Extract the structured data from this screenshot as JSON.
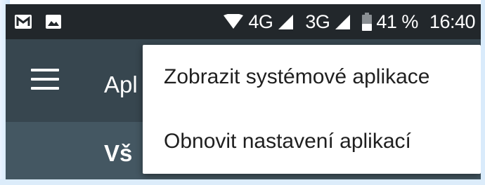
{
  "status_bar": {
    "notification_icons": [
      "gmail-icon",
      "image-icon"
    ],
    "signal_icons": [
      "wifi-icon",
      "signal-4g-icon",
      "signal-3g-icon",
      "battery-icon"
    ],
    "network_1": "4G",
    "network_2": "3G",
    "battery_percent": "41 %",
    "time": "16:40"
  },
  "toolbar": {
    "menu_icon": "hamburger-menu-icon",
    "title": "Apl"
  },
  "subheader": {
    "title": "Vš"
  },
  "overflow_menu": {
    "items": [
      {
        "label": "Zobrazit systémové aplikace"
      },
      {
        "label": "Obnovit nastavení aplikací"
      }
    ]
  },
  "colors": {
    "status_bar": "#22272b",
    "toolbar": "#37464f",
    "subheader": "#445762",
    "menu_background": "#ffffff",
    "menu_text": "#1f1f1f"
  }
}
